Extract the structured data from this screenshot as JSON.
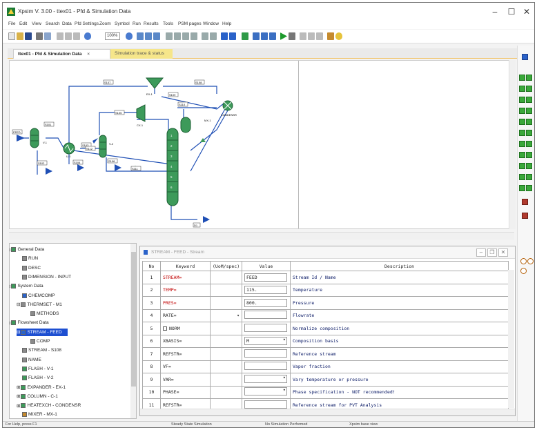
{
  "window": {
    "title": "Xpsim V. 3.00 - ttex01 - Pfd & Simulation Data",
    "controls": [
      "–",
      "☐",
      "✕"
    ]
  },
  "menu": [
    "File",
    "Edit",
    "View",
    "Search",
    "Data",
    "Pfd Settings",
    "Zoom",
    "Symbol",
    "Run",
    "Results",
    "Tools",
    "PSM pages",
    "Window",
    "Help"
  ],
  "toolbar": {
    "zoom": "100%"
  },
  "tabs": [
    {
      "label": "ttex01 - Pfd & Simulation Data",
      "close": "×"
    },
    {
      "label": "Simulation trace & status"
    }
  ],
  "flowsheet": {
    "streams": [
      "FEED",
      "S101",
      "S102",
      "S103",
      "S104",
      "S105",
      "S106",
      "S107",
      "S108",
      "S109",
      "S110",
      "S111",
      "S112",
      "D1"
    ],
    "units": [
      "V-1",
      "U-1",
      "V-2",
      "EX-1",
      "MX-1",
      "CX-1",
      "CONDENSR"
    ],
    "trays": [
      "1",
      "2",
      "3",
      "4",
      "5",
      "6"
    ]
  },
  "tree": [
    {
      "label": "General Data",
      "level": 0,
      "expander": "⊟"
    },
    {
      "label": "RUN",
      "level": 1
    },
    {
      "label": "DESC",
      "level": 1
    },
    {
      "label": "DIMENSION - INPUT",
      "level": 1
    },
    {
      "label": "System Data",
      "level": 0,
      "expander": "⊟"
    },
    {
      "label": "CHEMCOMP",
      "level": 1
    },
    {
      "label": "THERMSET - M1",
      "level": 1,
      "expander": "⊟"
    },
    {
      "label": "METHODS",
      "level": 2
    },
    {
      "label": "Flowsheet Data",
      "level": 0,
      "expander": "⊟"
    },
    {
      "label": "STREAM - FEED",
      "level": 1,
      "expander": "⊟",
      "selected": true
    },
    {
      "label": "COMP",
      "level": 2
    },
    {
      "label": "STREAM - S108",
      "level": 1
    },
    {
      "label": "NAME",
      "level": 1
    },
    {
      "label": "FLASH - V-1",
      "level": 1
    },
    {
      "label": "FLASH - V-2",
      "level": 1
    },
    {
      "label": "EXPANDER - EX-1",
      "level": 1,
      "expander": "⊞"
    },
    {
      "label": "COLUMN - C-1",
      "level": 1,
      "expander": "⊞"
    },
    {
      "label": "HEATEXCH - CONDENSR",
      "level": 1,
      "expander": "⊞"
    },
    {
      "label": "MIXER - MX-1",
      "level": 1
    }
  ],
  "panel": {
    "title": "STREAM - FEED - Stream",
    "columns": [
      "No",
      "Keyword",
      "(UoM/spec)",
      "Value",
      "Description"
    ],
    "rows": [
      {
        "no": "1",
        "keyword": "STREAM=",
        "red": true,
        "uom": "",
        "value": "FEED",
        "dropdown": false,
        "desc": "Stream Id / Name"
      },
      {
        "no": "2",
        "keyword": "TEMP=",
        "red": true,
        "uom": "",
        "value": "115.",
        "dropdown": false,
        "desc": "Temperature"
      },
      {
        "no": "3",
        "keyword": "PRES=",
        "red": true,
        "uom": "",
        "value": "800.",
        "dropdown": false,
        "desc": "Pressure"
      },
      {
        "no": "4",
        "keyword": "RATE=",
        "red": false,
        "uom": "▾",
        "value": "",
        "dropdown": false,
        "desc": "Flowrate"
      },
      {
        "no": "5",
        "keyword": "NORM",
        "red": false,
        "uom": "",
        "value": "",
        "dropdown": false,
        "checkbox": true,
        "desc": "Normalize composition"
      },
      {
        "no": "6",
        "keyword": "XBASIS=",
        "red": false,
        "uom": "",
        "value": "M",
        "dropdown": true,
        "desc": "Composition basis"
      },
      {
        "no": "7",
        "keyword": "REFSTR=",
        "red": false,
        "uom": "",
        "value": "",
        "dropdown": false,
        "desc": "Reference stream"
      },
      {
        "no": "8",
        "keyword": "VF=",
        "red": false,
        "uom": "",
        "value": "",
        "dropdown": false,
        "desc": "Vapor fraction"
      },
      {
        "no": "9",
        "keyword": "VAR=",
        "red": false,
        "uom": "",
        "value": "",
        "dropdown": true,
        "desc": "Vary temperature or pressure"
      },
      {
        "no": "10",
        "keyword": "PHASE=",
        "red": false,
        "uom": "",
        "value": "",
        "dropdown": true,
        "desc": "Phase specification - NOT recommended!"
      },
      {
        "no": "11",
        "keyword": "REFSTR=",
        "red": false,
        "uom": "",
        "value": "",
        "dropdown": false,
        "desc": "Reference stream for PVT Analysis"
      }
    ]
  },
  "status": [
    "For Help, press F1",
    "Steady State Simulation",
    "No Simulation Performed",
    "Xpsim base view"
  ],
  "colors": {
    "accent": "#1d4fd1",
    "keyword_red": "#c00000",
    "stream_blue": "#1f4fb5",
    "unit_green": "#3d9a5a"
  }
}
